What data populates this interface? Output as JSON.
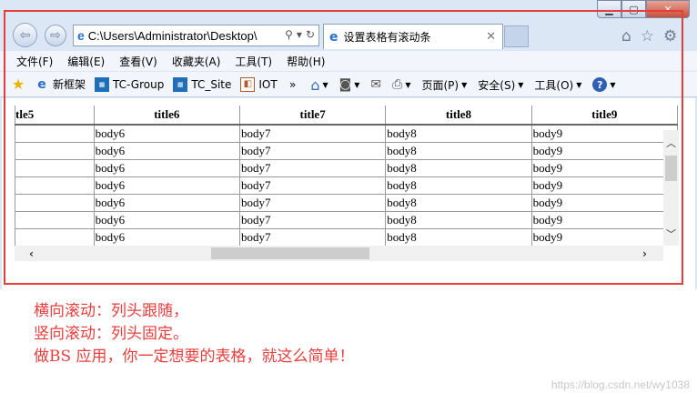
{
  "window": {
    "controls": {
      "minimize": "▁",
      "maximize": "▢",
      "close": "✕"
    }
  },
  "navbar": {
    "address": "C:\\Users\\Administrator\\Desktop\\",
    "tab_title": "设置表格有滚动条",
    "tab_close": "✕"
  },
  "menubar": {
    "items": [
      "文件(F)",
      "编辑(E)",
      "查看(V)",
      "收藏夹(A)",
      "工具(T)",
      "帮助(H)"
    ]
  },
  "favorites": {
    "items": [
      "新框架",
      "TC-Group",
      "TC_Site",
      "IOT"
    ],
    "more": "»"
  },
  "commands": {
    "page": "页面(P)",
    "safety": "安全(S)",
    "tools": "工具(O)"
  },
  "table": {
    "headers": [
      "tle5",
      "title6",
      "title7",
      "title8",
      "title9"
    ],
    "rows": [
      [
        "",
        "body6",
        "body7",
        "body8",
        "body9"
      ],
      [
        "",
        "body6",
        "body7",
        "body8",
        "body9"
      ],
      [
        "",
        "body6",
        "body7",
        "body8",
        "body9"
      ],
      [
        "",
        "body6",
        "body7",
        "body8",
        "body9"
      ],
      [
        "",
        "body6",
        "body7",
        "body8",
        "body9"
      ],
      [
        "",
        "body6",
        "body7",
        "body8",
        "body9"
      ],
      [
        "",
        "body6",
        "body7",
        "body8",
        "body9"
      ]
    ]
  },
  "caption": {
    "line1": "横向滚动：列头跟随，",
    "line2": "竖向滚动：列头固定。",
    "line3": "做BS 应用，你一定想要的表格，就这么简单！"
  },
  "watermark": "https://blog.csdn.net/wy1038",
  "colors": {
    "highlight_frame": "#e83d3d",
    "caption_text": "#e83d3d",
    "ie_blue": "#2a6fc9"
  }
}
